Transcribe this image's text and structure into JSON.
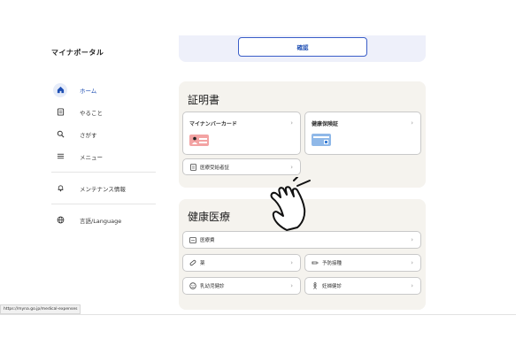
{
  "sidebar": {
    "brand": "マイナポータル",
    "items": [
      {
        "label": "ホーム",
        "icon": "home-icon"
      },
      {
        "label": "やること",
        "icon": "checklist-icon"
      },
      {
        "label": "さがす",
        "icon": "search-icon"
      },
      {
        "label": "メニュー",
        "icon": "menu-icon"
      },
      {
        "label": "メンテナンス情報",
        "icon": "bell-icon"
      },
      {
        "label": "言語/Language",
        "icon": "globe-icon"
      }
    ]
  },
  "main": {
    "confirm_label": "確認",
    "certificates": {
      "title": "証明書",
      "mynumber_card": "マイナンバーカード",
      "health_insurance": "健康保険証",
      "medical_recipient": "医療受給者証"
    },
    "health": {
      "title": "健康医療",
      "medical_expenses": "医療費",
      "medicine": "薬",
      "vaccination": "予防接種",
      "infant_checkup": "乳幼児健診",
      "maternal_checkup": "妊婦健診"
    }
  },
  "status": {
    "url": "https://myna.go.jp/medical-expenses"
  },
  "colors": {
    "accent": "#1f4fb3",
    "section_bg": "#f5f3ee",
    "top_bg": "#eef0fa"
  }
}
